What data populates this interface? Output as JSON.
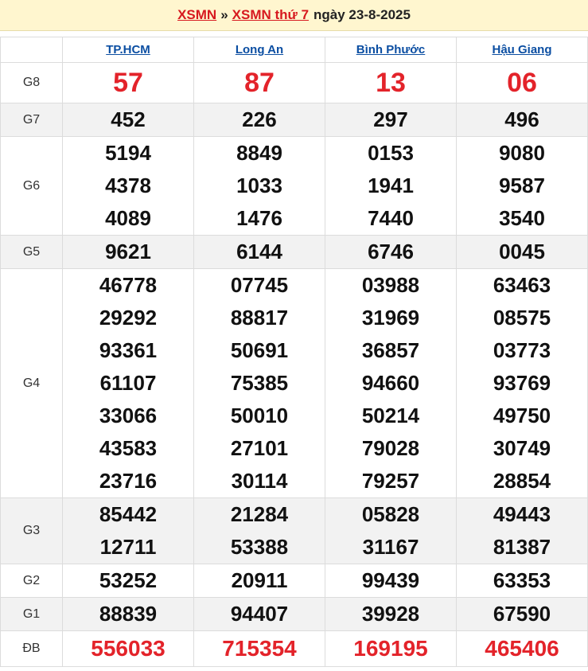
{
  "header": {
    "link1": "XSMN",
    "sep": "»",
    "link2": "XSMN thứ 7",
    "date_text": "ngày 23-8-2025"
  },
  "provinces": [
    "TP.HCM",
    "Long An",
    "Bình Phước",
    "Hậu Giang"
  ],
  "rows": {
    "g8": {
      "label": "G8",
      "values": [
        [
          "57"
        ],
        [
          "87"
        ],
        [
          "13"
        ],
        [
          "06"
        ]
      ]
    },
    "g7": {
      "label": "G7",
      "values": [
        [
          "452"
        ],
        [
          "226"
        ],
        [
          "297"
        ],
        [
          "496"
        ]
      ]
    },
    "g6": {
      "label": "G6",
      "values": [
        [
          "5194",
          "4378",
          "4089"
        ],
        [
          "8849",
          "1033",
          "1476"
        ],
        [
          "0153",
          "1941",
          "7440"
        ],
        [
          "9080",
          "9587",
          "3540"
        ]
      ]
    },
    "g5": {
      "label": "G5",
      "values": [
        [
          "9621"
        ],
        [
          "6144"
        ],
        [
          "6746"
        ],
        [
          "0045"
        ]
      ]
    },
    "g4": {
      "label": "G4",
      "values": [
        [
          "46778",
          "29292",
          "93361",
          "61107",
          "33066",
          "43583",
          "23716"
        ],
        [
          "07745",
          "88817",
          "50691",
          "75385",
          "50010",
          "27101",
          "30114"
        ],
        [
          "03988",
          "31969",
          "36857",
          "94660",
          "50214",
          "79028",
          "79257"
        ],
        [
          "63463",
          "08575",
          "03773",
          "93769",
          "49750",
          "30749",
          "28854"
        ]
      ]
    },
    "g3": {
      "label": "G3",
      "values": [
        [
          "85442",
          "12711"
        ],
        [
          "21284",
          "53388"
        ],
        [
          "05828",
          "31167"
        ],
        [
          "49443",
          "81387"
        ]
      ]
    },
    "g2": {
      "label": "G2",
      "values": [
        [
          "53252"
        ],
        [
          "20911"
        ],
        [
          "99439"
        ],
        [
          "63353"
        ]
      ]
    },
    "g1": {
      "label": "G1",
      "values": [
        [
          "88839"
        ],
        [
          "94407"
        ],
        [
          "39928"
        ],
        [
          "67590"
        ]
      ]
    },
    "db": {
      "label": "ĐB",
      "values": [
        [
          "556033"
        ],
        [
          "715354"
        ],
        [
          "169195"
        ],
        [
          "465406"
        ]
      ]
    }
  },
  "colors": {
    "accent_red": "#e3232a",
    "link_blue": "#0b4ea2",
    "header_bg": "#fff6cf"
  }
}
